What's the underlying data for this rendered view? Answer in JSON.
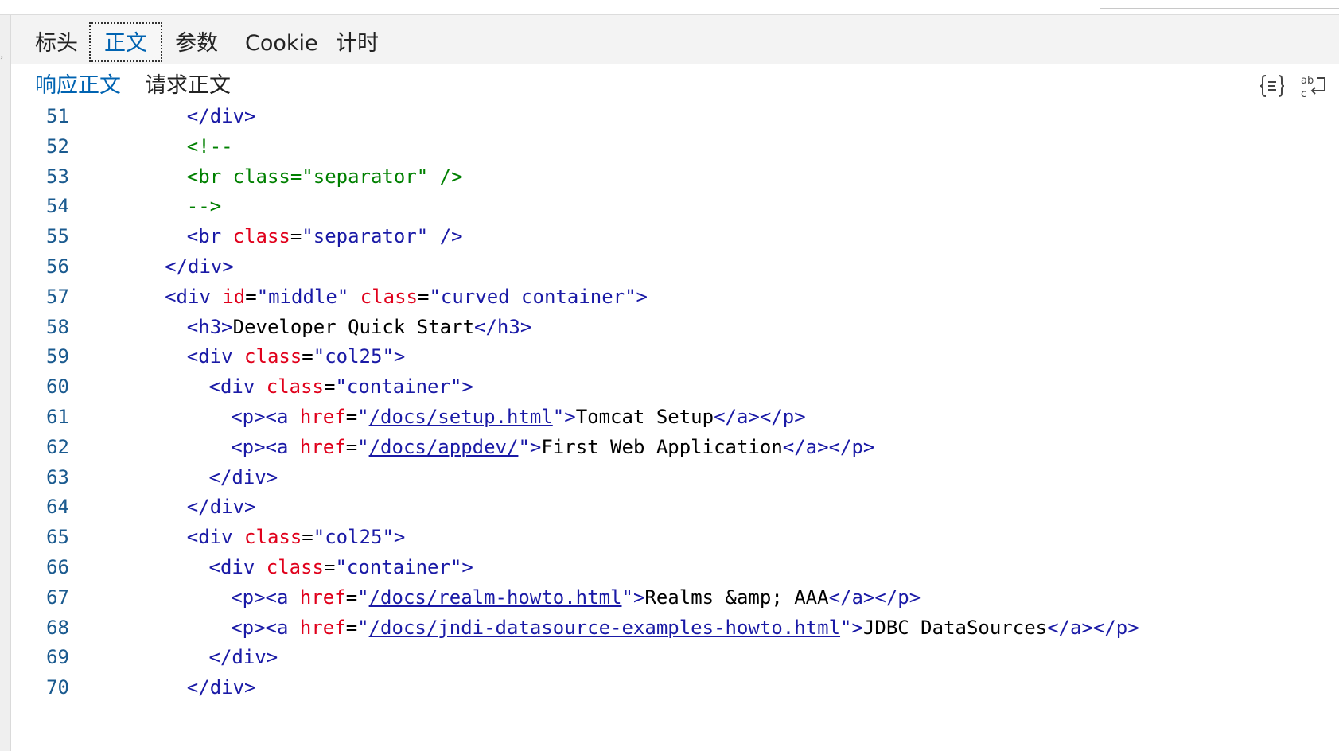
{
  "tabs": [
    {
      "label": "标头",
      "active": false
    },
    {
      "label": "正文",
      "active": true
    },
    {
      "label": "参数",
      "active": false
    },
    {
      "label": "Cookie",
      "active": false
    },
    {
      "label": "计时",
      "active": false
    }
  ],
  "subtabs": [
    {
      "label": "响应正文",
      "active": true
    },
    {
      "label": "请求正文",
      "active": false
    }
  ],
  "toolbar": {
    "format_icon": "pretty-print-icon",
    "wrap_icon": "word-wrap-icon"
  },
  "colors": {
    "accent": "#0063b1",
    "tag": "#1a1aa6",
    "attr": "#e0001b",
    "comment": "#008000",
    "line_number": "#1a5a8f"
  },
  "code_lines": [
    {
      "n": "51",
      "indent": 8,
      "tokens": [
        [
          "tag",
          "</div>"
        ]
      ]
    },
    {
      "n": "52",
      "indent": 8,
      "tokens": [
        [
          "comment",
          "<!--"
        ]
      ]
    },
    {
      "n": "53",
      "indent": 8,
      "tokens": [
        [
          "comment",
          "<br class=\"separator\" />"
        ]
      ]
    },
    {
      "n": "54",
      "indent": 8,
      "tokens": [
        [
          "comment",
          "-->"
        ]
      ]
    },
    {
      "n": "55",
      "indent": 8,
      "tokens": [
        [
          "tag",
          "<br "
        ],
        [
          "attr",
          "class"
        ],
        [
          "text",
          "="
        ],
        [
          "val",
          "\"separator\""
        ],
        [
          "tag",
          " />"
        ]
      ]
    },
    {
      "n": "56",
      "indent": 6,
      "tokens": [
        [
          "tag",
          "</div>"
        ]
      ]
    },
    {
      "n": "57",
      "indent": 6,
      "tokens": [
        [
          "tag",
          "<div "
        ],
        [
          "attr",
          "id"
        ],
        [
          "text",
          "="
        ],
        [
          "val",
          "\"middle\""
        ],
        [
          "text",
          " "
        ],
        [
          "attr",
          "class"
        ],
        [
          "text",
          "="
        ],
        [
          "val",
          "\"curved container\""
        ],
        [
          "tag",
          ">"
        ]
      ]
    },
    {
      "n": "58",
      "indent": 8,
      "tokens": [
        [
          "tag",
          "<h3>"
        ],
        [
          "text",
          "Developer Quick Start"
        ],
        [
          "tag",
          "</h3>"
        ]
      ]
    },
    {
      "n": "59",
      "indent": 8,
      "tokens": [
        [
          "tag",
          "<div "
        ],
        [
          "attr",
          "class"
        ],
        [
          "text",
          "="
        ],
        [
          "val",
          "\"col25\""
        ],
        [
          "tag",
          ">"
        ]
      ]
    },
    {
      "n": "60",
      "indent": 10,
      "tokens": [
        [
          "tag",
          "<div "
        ],
        [
          "attr",
          "class"
        ],
        [
          "text",
          "="
        ],
        [
          "val",
          "\"container\""
        ],
        [
          "tag",
          ">"
        ]
      ]
    },
    {
      "n": "61",
      "indent": 12,
      "tokens": [
        [
          "tag",
          "<p><a "
        ],
        [
          "attr",
          "href"
        ],
        [
          "text",
          "="
        ],
        [
          "val",
          "\""
        ],
        [
          "link",
          "/docs/setup.html"
        ],
        [
          "val",
          "\""
        ],
        [
          "tag",
          ">"
        ],
        [
          "text",
          "Tomcat Setup"
        ],
        [
          "tag",
          "</a></p>"
        ]
      ]
    },
    {
      "n": "62",
      "indent": 12,
      "tokens": [
        [
          "tag",
          "<p><a "
        ],
        [
          "attr",
          "href"
        ],
        [
          "text",
          "="
        ],
        [
          "val",
          "\""
        ],
        [
          "link",
          "/docs/appdev/"
        ],
        [
          "val",
          "\""
        ],
        [
          "tag",
          ">"
        ],
        [
          "text",
          "First Web Application"
        ],
        [
          "tag",
          "</a></p>"
        ]
      ]
    },
    {
      "n": "63",
      "indent": 10,
      "tokens": [
        [
          "tag",
          "</div>"
        ]
      ]
    },
    {
      "n": "64",
      "indent": 8,
      "tokens": [
        [
          "tag",
          "</div>"
        ]
      ]
    },
    {
      "n": "65",
      "indent": 8,
      "tokens": [
        [
          "tag",
          "<div "
        ],
        [
          "attr",
          "class"
        ],
        [
          "text",
          "="
        ],
        [
          "val",
          "\"col25\""
        ],
        [
          "tag",
          ">"
        ]
      ]
    },
    {
      "n": "66",
      "indent": 10,
      "tokens": [
        [
          "tag",
          "<div "
        ],
        [
          "attr",
          "class"
        ],
        [
          "text",
          "="
        ],
        [
          "val",
          "\"container\""
        ],
        [
          "tag",
          ">"
        ]
      ]
    },
    {
      "n": "67",
      "indent": 12,
      "tokens": [
        [
          "tag",
          "<p><a "
        ],
        [
          "attr",
          "href"
        ],
        [
          "text",
          "="
        ],
        [
          "val",
          "\""
        ],
        [
          "link",
          "/docs/realm-howto.html"
        ],
        [
          "val",
          "\""
        ],
        [
          "tag",
          ">"
        ],
        [
          "text",
          "Realms &amp; AAA"
        ],
        [
          "tag",
          "</a></p>"
        ]
      ]
    },
    {
      "n": "68",
      "indent": 12,
      "tokens": [
        [
          "tag",
          "<p><a "
        ],
        [
          "attr",
          "href"
        ],
        [
          "text",
          "="
        ],
        [
          "val",
          "\""
        ],
        [
          "link",
          "/docs/jndi-datasource-examples-howto.html"
        ],
        [
          "val",
          "\""
        ],
        [
          "tag",
          ">"
        ],
        [
          "text",
          "JDBC DataSources"
        ],
        [
          "tag",
          "</a></p>"
        ]
      ]
    },
    {
      "n": "69",
      "indent": 10,
      "tokens": [
        [
          "tag",
          "</div>"
        ]
      ]
    },
    {
      "n": "70",
      "indent": 8,
      "tokens": [
        [
          "tag",
          "</div>"
        ]
      ]
    }
  ]
}
